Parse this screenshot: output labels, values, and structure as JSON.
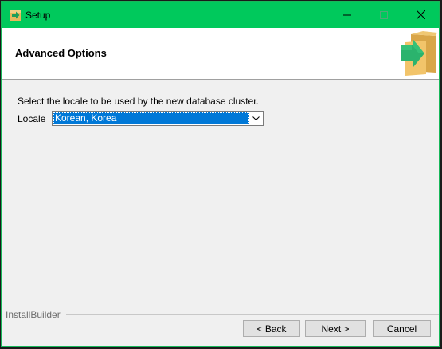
{
  "window": {
    "title": "Setup",
    "icons": {
      "app": "installer-arrow-icon",
      "minimize": "minimize-icon",
      "maximize": "maximize-icon",
      "close": "close-icon",
      "logo": "box-arrow-logo"
    }
  },
  "header": {
    "title": "Advanced Options"
  },
  "main": {
    "prompt": "Select the locale to be used by the new database cluster.",
    "locale_label": "Locale",
    "locale_value": "Korean, Korea"
  },
  "footer": {
    "brand": "InstallBuilder",
    "back_label": "< Back",
    "next_label": "Next >",
    "cancel_label": "Cancel"
  },
  "colors": {
    "titlebar": "#00c95c",
    "selection": "#0078d7",
    "logo_box": "#e8b85c",
    "logo_arrow": "#2bb36d"
  }
}
